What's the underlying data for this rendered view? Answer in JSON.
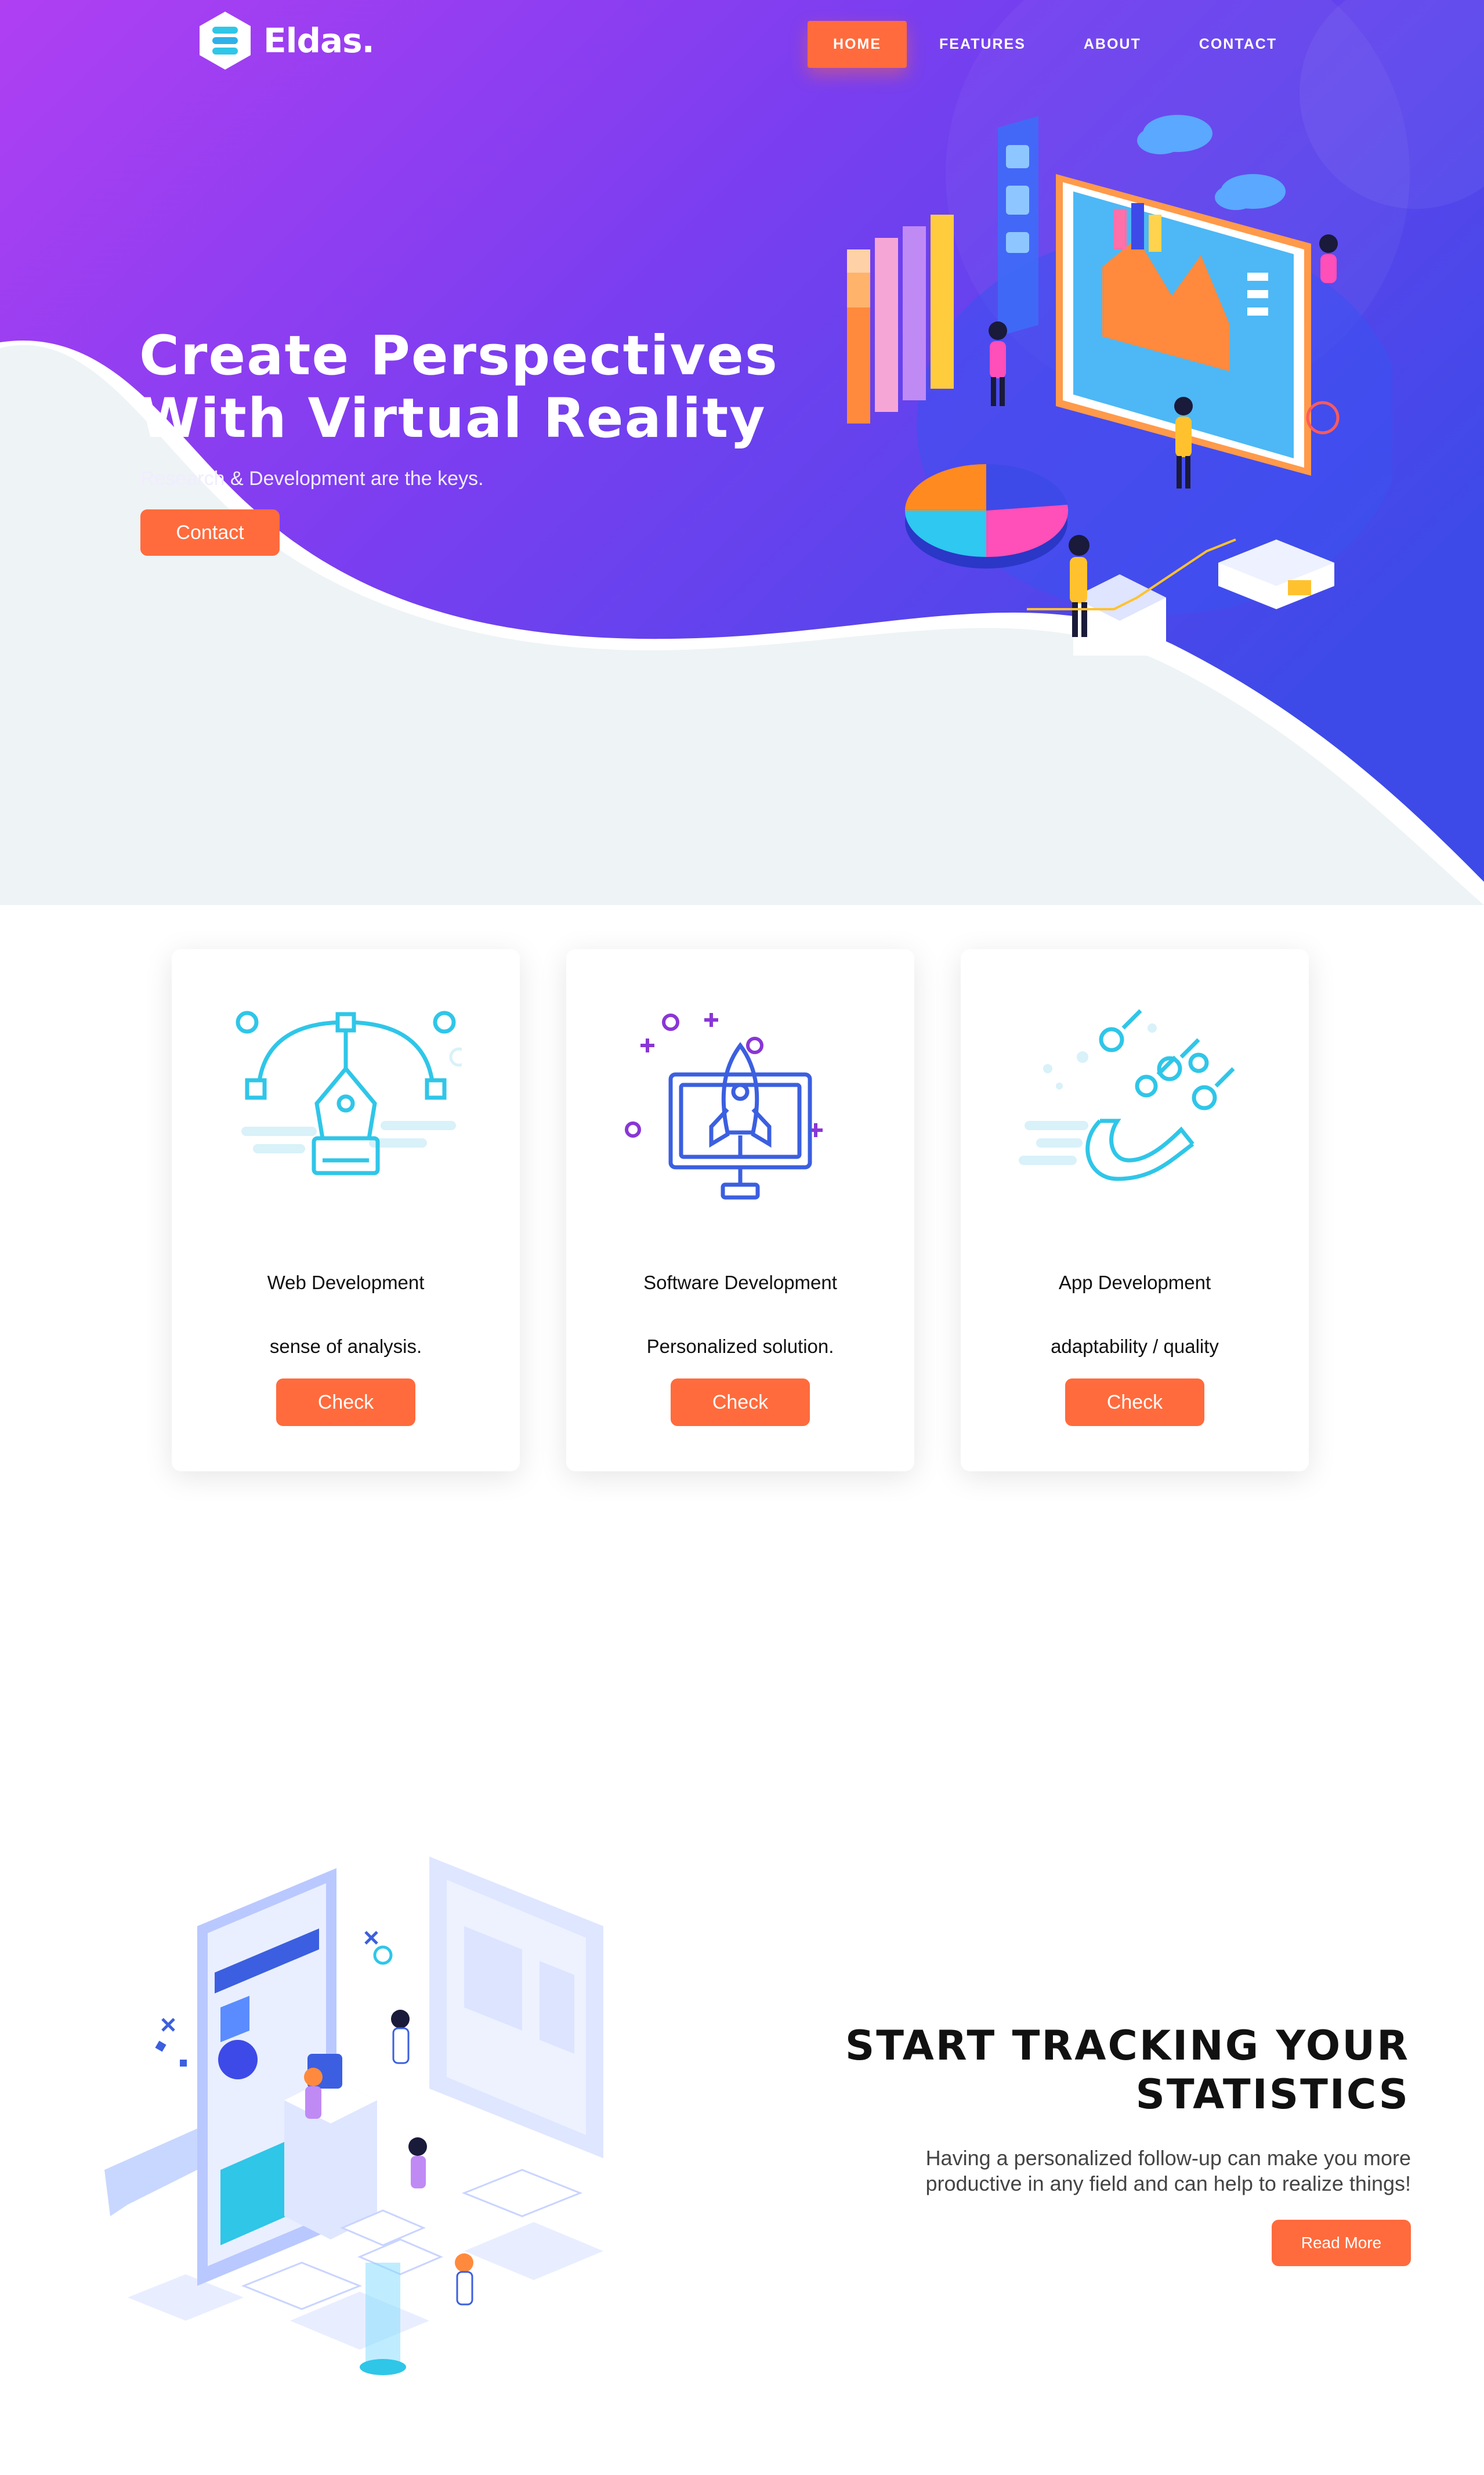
{
  "brand": {
    "name": "Eldas.",
    "logo_icon": "stack-layers-icon"
  },
  "nav": {
    "items": [
      {
        "label": "HOME",
        "active": true
      },
      {
        "label": "FEATURES",
        "active": false
      },
      {
        "label": "ABOUT",
        "active": false
      },
      {
        "label": "CONTACT",
        "active": false
      }
    ]
  },
  "hero": {
    "title_line1": "Create Perspectives",
    "title_line2": "With Virtual Reality",
    "subtitle": "Research & Development are the keys.",
    "cta_label": "Contact",
    "illustration": "isometric-dashboard-illustration"
  },
  "services": [
    {
      "title": "Web Development",
      "text": "sense of analysis.",
      "button": "Check",
      "icon": "pen-tool-icon"
    },
    {
      "title": "Software Development",
      "text": "Personalized solution.",
      "button": "Check",
      "icon": "rocket-monitor-icon"
    },
    {
      "title": "App Development",
      "text": "adaptability / quality",
      "button": "Check",
      "icon": "magnet-icon"
    }
  ],
  "stats": {
    "title_line1": "START TRACKING YOUR",
    "title_line2": "STATISTICS",
    "text_line1": "Having a personalized follow-up can make you more",
    "text_line2": "productive in any field and can help to realize things!",
    "button": "Read More",
    "illustration": "isometric-mobile-app-illustration"
  },
  "colors": {
    "accent": "#ff6b3d",
    "hero_gradient_start": "#a53ff0",
    "hero_gradient_end": "#3b49e8",
    "icon_cyan": "#2fc6e8",
    "icon_blue": "#3b5fe0",
    "icon_purple": "#8a36d6"
  }
}
